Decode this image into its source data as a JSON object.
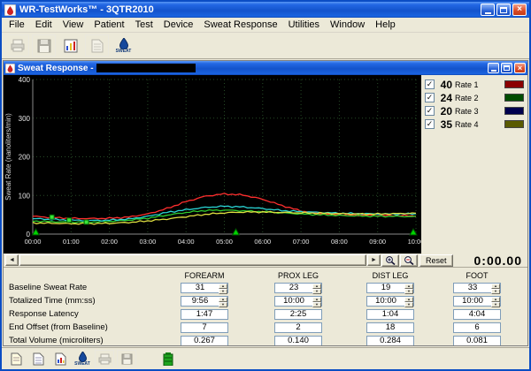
{
  "window": {
    "title": "WR-TestWorks™ - 3QTR2010"
  },
  "menu": {
    "items": [
      "File",
      "Edit",
      "View",
      "Patient",
      "Test",
      "Device",
      "Sweat Response",
      "Utilities",
      "Window",
      "Help"
    ]
  },
  "toolbar": {
    "sweat_label": "SWEAT"
  },
  "child_window": {
    "title": "Sweat Response -"
  },
  "legend": {
    "rows": [
      {
        "value": "40",
        "label": "Rate 1",
        "swatch": "#8b0000"
      },
      {
        "value": "24",
        "label": "Rate 2",
        "swatch": "#004d00"
      },
      {
        "value": "20",
        "label": "Rate 3",
        "swatch": "#00004d"
      },
      {
        "value": "35",
        "label": "Rate 4",
        "swatch": "#5a5a00"
      }
    ]
  },
  "controls": {
    "reset_label": "Reset",
    "timer": "0:00.00"
  },
  "table": {
    "columns": [
      "FOREARM",
      "PROX LEG",
      "DIST LEG",
      "FOOT"
    ],
    "rows": [
      {
        "label": "Baseline Sweat Rate",
        "values": [
          "31",
          "23",
          "19",
          "33"
        ],
        "spinner": true
      },
      {
        "label": "Totalized Time (mm:ss)",
        "values": [
          "9:56",
          "10:00",
          "10:00",
          "10:00"
        ],
        "spinner": true
      },
      {
        "label": "Response Latency",
        "values": [
          "1:47",
          "2:25",
          "1:04",
          "4:04"
        ],
        "spinner": false
      },
      {
        "label": "End Offset (from Baseline)",
        "values": [
          "7",
          "2",
          "18",
          "6"
        ],
        "spinner": false
      },
      {
        "label": "Total Volume (microliters)",
        "values": [
          "0.267",
          "0.140",
          "0.284",
          "0.081"
        ],
        "spinner": false
      }
    ]
  },
  "bottom_toolbar": {
    "sweat_label": "SWEAT"
  },
  "chart_data": {
    "type": "line",
    "title": "",
    "ylabel": "Sweat Rate (nanoliters/min)",
    "ylim": [
      0,
      400
    ],
    "yticks": [
      0,
      100,
      200,
      300,
      400
    ],
    "xlim_min": [
      0,
      10
    ],
    "x_step_min": 0.5,
    "xtick_labels": [
      "00:00",
      "01:00",
      "02:00",
      "03:00",
      "04:00",
      "05:00",
      "06:00",
      "07:00",
      "08:00",
      "09:00",
      "10:00"
    ],
    "grid": true,
    "plot_bg": "#000000",
    "legend_position": "right-panel",
    "series": [
      {
        "name": "Rate 1",
        "color": "#ff2e2e",
        "values": [
          46,
          43,
          41,
          40,
          41,
          44,
          52,
          66,
          84,
          98,
          104,
          101,
          90,
          74,
          60,
          53,
          50,
          49,
          48,
          48,
          47
        ]
      },
      {
        "name": "Rate 2",
        "color": "#2ecc2e",
        "values": [
          34,
          32,
          31,
          31,
          33,
          36,
          41,
          49,
          56,
          61,
          62,
          60,
          58,
          55,
          52,
          50,
          48,
          47,
          46,
          46,
          45
        ]
      },
      {
        "name": "Rate 3",
        "color": "#2ad4d4",
        "values": [
          40,
          38,
          36,
          35,
          36,
          39,
          46,
          56,
          63,
          69,
          72,
          70,
          66,
          61,
          58,
          56,
          54,
          53,
          52,
          52,
          53
        ]
      },
      {
        "name": "Rate 4",
        "color": "#e0e040",
        "values": [
          29,
          28,
          27,
          27,
          28,
          30,
          34,
          39,
          45,
          51,
          55,
          57,
          57,
          56,
          55,
          54,
          53,
          52,
          52,
          53,
          54
        ]
      }
    ],
    "event_markers_min": [
      0.08,
      5.3,
      9.93
    ],
    "baseline_markers": [
      {
        "t": 0.5,
        "v": 44
      },
      {
        "t": 0.95,
        "v": 36
      },
      {
        "t": 1.4,
        "v": 31
      }
    ]
  }
}
